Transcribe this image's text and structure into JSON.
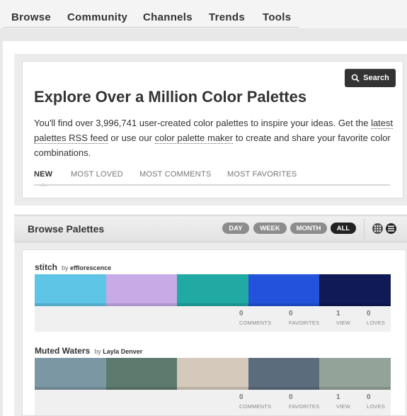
{
  "nav": {
    "items": [
      "Browse",
      "Community",
      "Channels",
      "Trends",
      "Tools"
    ]
  },
  "explore": {
    "search_label": "Search",
    "title": "Explore Over a Million Color Palettes",
    "desc_part1": "You'll find over 3,996,741 user-created color palettes to inspire your ideas. Get the ",
    "link_rss": "latest palettes RSS feed",
    "desc_part2": " or use our ",
    "link_maker": "color palette maker",
    "desc_part3": " to create and share your favorite color combinations.",
    "tabs": [
      "NEW",
      "MOST LOVED",
      "MOST COMMENTS",
      "MOST FAVORITES"
    ],
    "active_tab": "NEW"
  },
  "browse": {
    "title": "Browse Palettes",
    "periods": [
      "DAY",
      "WEEK",
      "MONTH",
      "ALL"
    ],
    "active_period": "ALL",
    "view_icons": [
      "grid-view-icon",
      "list-view-icon"
    ]
  },
  "palettes": [
    {
      "title": "stitch",
      "by_label": "by",
      "author": "efflorescence",
      "colors": [
        "#5fc5e6",
        "#c8abe6",
        "#21a9a4",
        "#2353da",
        "#0f1a56"
      ],
      "stats": [
        {
          "num": "0",
          "label": "COMMENTS"
        },
        {
          "num": "0",
          "label": "FAVORITES"
        },
        {
          "num": "1",
          "label": "VIEW"
        },
        {
          "num": "0",
          "label": "LOVES"
        }
      ]
    },
    {
      "title": "Muted Waters",
      "by_label": "by",
      "author": "Layla Denver",
      "colors": [
        "#7c97a4",
        "#5d7a6f",
        "#d4c9bb",
        "#5b6d7d",
        "#93a39a"
      ],
      "stats": [
        {
          "num": "0",
          "label": "COMMENTS"
        },
        {
          "num": "0",
          "label": "FAVORITES"
        },
        {
          "num": "1",
          "label": "VIEW"
        },
        {
          "num": "0",
          "label": "LOVES"
        }
      ]
    }
  ]
}
